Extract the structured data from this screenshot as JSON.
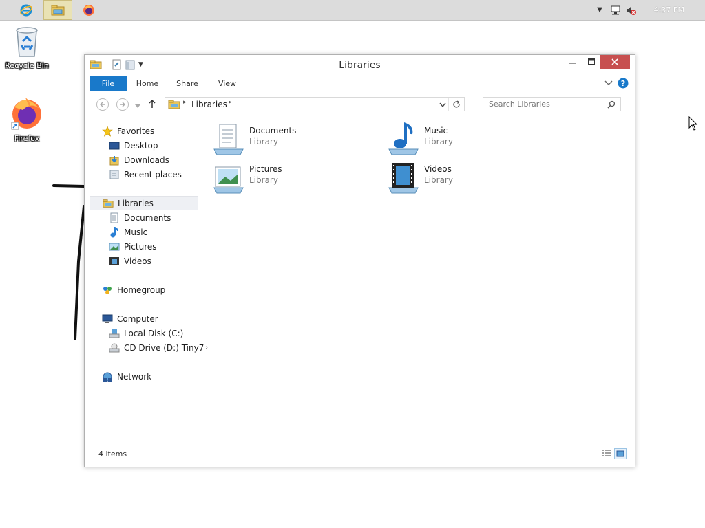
{
  "taskbar": {
    "pinned": [
      {
        "name": "internet-explorer-icon"
      },
      {
        "name": "file-explorer-icon"
      },
      {
        "name": "firefox-icon"
      }
    ],
    "clock": "4:37 PM"
  },
  "desktop": {
    "icons": [
      {
        "label": "Recycle Bin"
      },
      {
        "label": "Firefox"
      }
    ]
  },
  "window": {
    "title": "Libraries",
    "ribbon_tabs": [
      "File",
      "Home",
      "Share",
      "View"
    ],
    "address": {
      "segment": "Libraries"
    },
    "search_placeholder": "Search Libraries",
    "nav": {
      "favorites": {
        "label": "Favorites",
        "items": [
          "Desktop",
          "Downloads",
          "Recent places"
        ]
      },
      "libraries": {
        "label": "Libraries",
        "items": [
          "Documents",
          "Music",
          "Pictures",
          "Videos"
        ]
      },
      "homegroup": "Homegroup",
      "computer": {
        "label": "Computer",
        "items": [
          "Local Disk (C:)",
          "CD Drive (D:) Tiny7"
        ]
      },
      "network": "Network"
    },
    "libraries": [
      {
        "name": "Documents",
        "kind": "Library"
      },
      {
        "name": "Music",
        "kind": "Library"
      },
      {
        "name": "Pictures",
        "kind": "Library"
      },
      {
        "name": "Videos",
        "kind": "Library"
      }
    ],
    "status": "4 items"
  },
  "colors": {
    "accent": "#1979ca",
    "close": "#c75050",
    "taskbar": "#dcdcdc"
  }
}
